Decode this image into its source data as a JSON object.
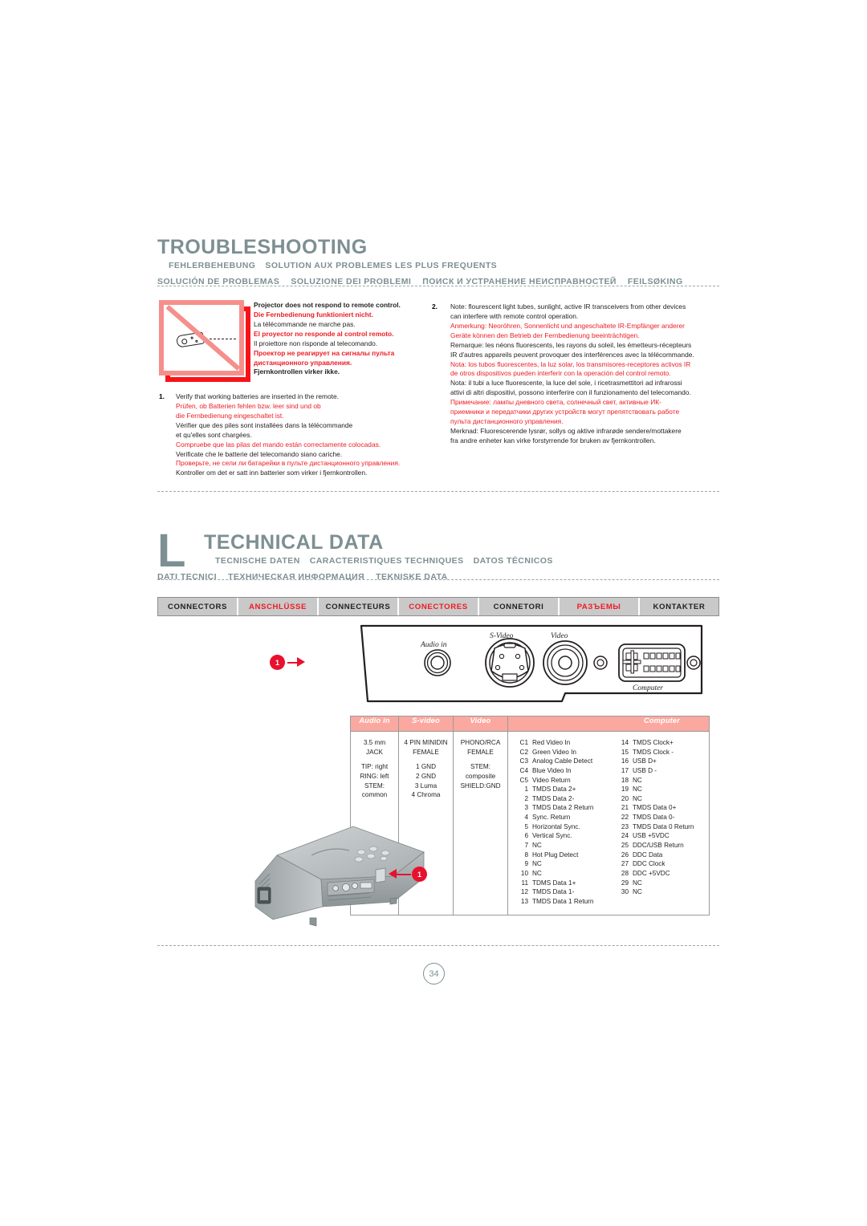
{
  "troubleshooting": {
    "title": "TROUBLESHOOTING",
    "subtitles_line1": [
      "FEHLERBEHEBUNG",
      "SOLUTION AUX PROBLEMES LES PLUS FREQUENTS"
    ],
    "subtitles_line2": [
      "SOLUCIÓN DE PROBLEMAS",
      "SOLUZIONE DEI PROBLEMI",
      "ПОИСК И УСТРАНЕНИЕ НЕИСПРАВНОСТЕЙ",
      "FEILSØKING"
    ],
    "symptom": [
      {
        "text": "Projector does not respond to remote control.",
        "red": false
      },
      {
        "text": "Die Fernbedienung funktioniert nicht.",
        "red": true
      },
      {
        "text": "La télécommande ne marche pas.",
        "red": false
      },
      {
        "text": "El proyector no responde al control remoto.",
        "red": true
      },
      {
        "text": "Il proiettore non risponde al telecomando.",
        "red": false
      },
      {
        "text": "Проектор не реагирует на сигналы пульта",
        "red": true
      },
      {
        "text": "дистанционного управления.",
        "red": true
      },
      {
        "text": "Fjernkontrollen virker ikke.",
        "red": false
      }
    ],
    "item1": {
      "number": "1.",
      "lines": [
        {
          "text": "Verify that working batteries are inserted in the remote.",
          "red": false
        },
        {
          "text": "Prüfen, ob Batterien fehlen bzw. leer sind und ob",
          "red": true
        },
        {
          "text": "die Fernbedienung eingeschaltet ist.",
          "red": true
        },
        {
          "text": "Vérifier que des piles sont installées dans la télécommande",
          "red": false
        },
        {
          "text": "et qu'elles sont chargées.",
          "red": false
        },
        {
          "text": "Compruebe que las pilas del mando están correctamente colocadas.",
          "red": true
        },
        {
          "text": "Verificate che le batterie del telecomando siano cariche.",
          "red": false
        },
        {
          "text": "Проверьте, не сели ли батарейки в пульте дистанционного управления.",
          "red": true
        },
        {
          "text": "Kontroller om det er satt inn batterier som virker i fjernkontrollen.",
          "red": false
        }
      ]
    },
    "item2": {
      "number": "2.",
      "lines": [
        {
          "text": "Note: flourescent light tubes, sunlight, active IR transceivers from other devices",
          "red": false
        },
        {
          "text": "can interfere with remote control operation.",
          "red": false
        },
        {
          "text": "Anmerkung: Neoröhren, Sonnenlicht und angeschaltete IR-Empfänger anderer",
          "red": true
        },
        {
          "text": "Geräte können den Betrieb der Fernbedienung beeinträchtigen.",
          "red": true
        },
        {
          "text": "Remarque: les néons fluorescents, les rayons du soleil, les émetteurs-récepteurs",
          "red": false
        },
        {
          "text": "IR d'autres appareils peuvent provoquer des interférences avec la télécommande.",
          "red": false
        },
        {
          "text": "Nota: los tubos fluorescentes, la luz solar, los transmisores-receptores activos IR",
          "red": true
        },
        {
          "text": "de otros dispositivos pueden interferir con la operación del control remoto.",
          "red": true
        },
        {
          "text": "Nota: il tubi a luce fluorescente, la luce del sole, i ricetrasmettitori ad infrarossi",
          "red": false
        },
        {
          "text": "attivi di altri dispositivi, possono interferire con il funzionamento del telecomando.",
          "red": false
        },
        {
          "text": "Примечание: лампы дневного света, солнечный свет, активные ИК-",
          "red": true
        },
        {
          "text": "приемники и передатчики других устройств могут препятствовать работе",
          "red": true
        },
        {
          "text": "пульта дистанционного управления.",
          "red": true
        },
        {
          "text": "Merknad: Fluorescerende lysrør, sollys og aktive infrarøde sendere/mottakere",
          "red": false
        },
        {
          "text": "fra andre enheter kan virke forstyrrende for bruken av fjernkontrollen.",
          "red": false
        }
      ]
    }
  },
  "technical": {
    "title": "TECHNICAL DATA",
    "lmark": "L",
    "subtitles_line1": [
      "TECNISCHE DATEN",
      "CARACTERISTIQUES TECHNIQUES",
      "DATOS TÉCNICOS"
    ],
    "subtitles_line2": [
      "DATI TECNICI",
      "ТЕХНИЧЕСКАЯ ИНФОРМАЦИЯ",
      "TEKNISKE DATA"
    ],
    "tabs": [
      {
        "label": "CONNECTORS",
        "red": false
      },
      {
        "label": "ANSCHLÜSSE",
        "red": true
      },
      {
        "label": "CONNECTEURS",
        "red": false
      },
      {
        "label": "CONECTORES",
        "red": true
      },
      {
        "label": "CONNETORI",
        "red": false
      },
      {
        "label": "РАЗЪЕМЫ",
        "red": true
      },
      {
        "label": "KONTAKTER",
        "red": false
      }
    ]
  },
  "panel_diagram": {
    "callout": "1",
    "labels": {
      "audio_in": "Audio in",
      "s_video": "S-Video",
      "video": "Video",
      "computer": "Computer"
    }
  },
  "projector_image": {
    "callout": "1"
  },
  "spec_table": {
    "headers": [
      "Audio in",
      "S-video",
      "Video",
      "Computer"
    ],
    "audio_in": [
      "3.5 mm",
      "JACK",
      "",
      "TIP: right",
      "RING: left",
      "STEM: common"
    ],
    "s_video": [
      "4 PIN MINIDIN",
      "FEMALE",
      "",
      "1  GND",
      "2  GND",
      "3  Luma",
      "4  Chroma"
    ],
    "video": [
      "PHONO/RCA",
      "FEMALE",
      "",
      "STEM: composite",
      "SHIELD:GND"
    ],
    "computer_left": [
      {
        "pin": "C1",
        "name": "Red Video In"
      },
      {
        "pin": "C2",
        "name": "Green Video In"
      },
      {
        "pin": "C3",
        "name": "Analog Cable Detect"
      },
      {
        "pin": "C4",
        "name": "Blue Video In"
      },
      {
        "pin": "C5",
        "name": "Video Return"
      },
      {
        "pin": "1",
        "name": "TMDS Data 2+"
      },
      {
        "pin": "2",
        "name": "TMDS Data 2-"
      },
      {
        "pin": "3",
        "name": "TMDS Data 2 Return"
      },
      {
        "pin": "4",
        "name": "Sync. Return"
      },
      {
        "pin": "5",
        "name": "Horizontal Sync."
      },
      {
        "pin": "6",
        "name": "Vertical Sync."
      },
      {
        "pin": "7",
        "name": "NC"
      },
      {
        "pin": "8",
        "name": "Hot Plug Detect"
      },
      {
        "pin": "9",
        "name": "NC"
      },
      {
        "pin": "10",
        "name": "NC"
      },
      {
        "pin": "11",
        "name": "TDMS Data 1+"
      },
      {
        "pin": "12",
        "name": "TMDS Data 1-"
      },
      {
        "pin": "13",
        "name": "TMDS Data 1 Return"
      }
    ],
    "computer_right": [
      {
        "pin": "14",
        "name": "TMDS Clock+"
      },
      {
        "pin": "15",
        "name": "TMDS Clock -"
      },
      {
        "pin": "16",
        "name": "USB D+"
      },
      {
        "pin": "17",
        "name": "USB D -"
      },
      {
        "pin": "18",
        "name": "NC"
      },
      {
        "pin": "19",
        "name": "NC"
      },
      {
        "pin": "20",
        "name": "NC"
      },
      {
        "pin": "21",
        "name": "TMDS Data 0+"
      },
      {
        "pin": "22",
        "name": "TMDS Data 0-"
      },
      {
        "pin": "23",
        "name": "TMDS Data 0 Return"
      },
      {
        "pin": "24",
        "name": "USB  +5VDC"
      },
      {
        "pin": "25",
        "name": "DDC/USB Return"
      },
      {
        "pin": "26",
        "name": "DDC Data"
      },
      {
        "pin": "27",
        "name": "DDC Clock"
      },
      {
        "pin": "28",
        "name": "DDC +5VDC"
      },
      {
        "pin": "29",
        "name": "NC"
      },
      {
        "pin": "30",
        "name": "NC"
      }
    ]
  },
  "footer": {
    "page_number": "34"
  },
  "colors": {
    "heading": "#7D8F93",
    "red": "#ED1C24",
    "badge_red": "#E8112D",
    "table_header_pink": "#FBA9A0",
    "tab_gray": "#C9C9C9"
  }
}
